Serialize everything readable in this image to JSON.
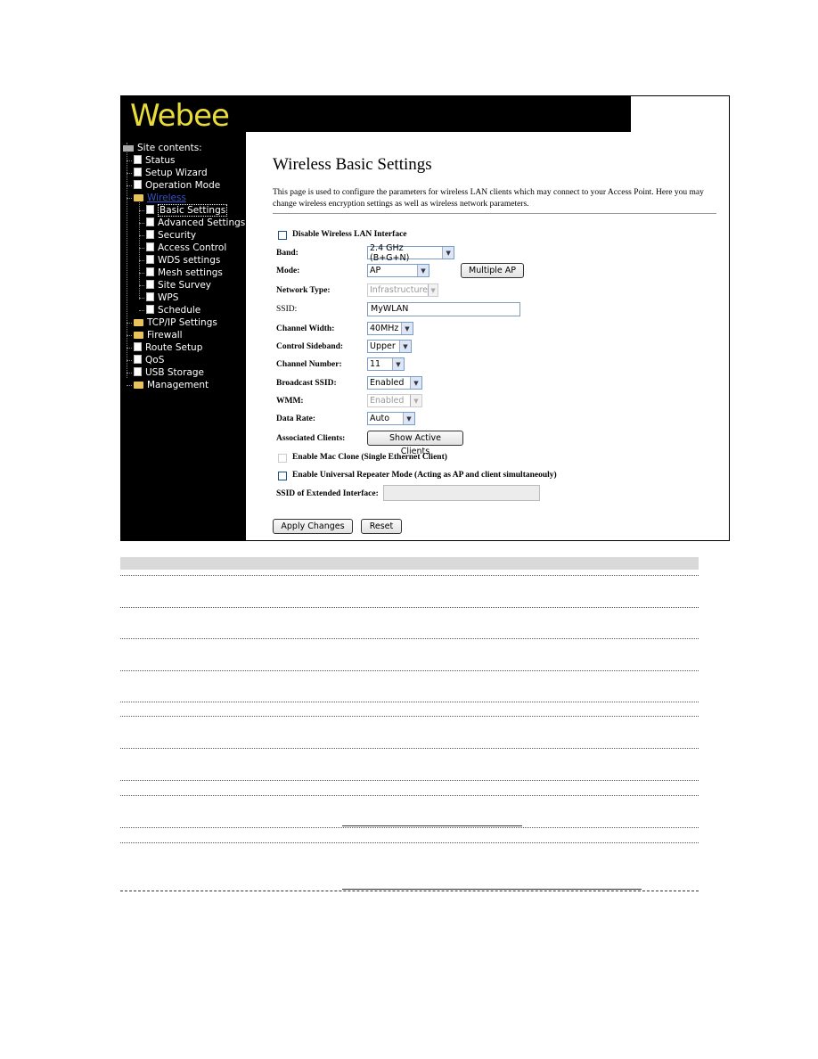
{
  "app": {
    "logo_text": "Webee"
  },
  "sidebar": {
    "root_label": "Site contents:",
    "items": [
      {
        "label": "Status",
        "type": "page",
        "level": 1
      },
      {
        "label": "Setup Wizard",
        "type": "page",
        "level": 1
      },
      {
        "label": "Operation Mode",
        "type": "page",
        "level": 1
      },
      {
        "label": "Wireless",
        "type": "folder-open",
        "level": 1
      },
      {
        "label": "Basic Settings",
        "type": "page",
        "level": 2,
        "selected": true
      },
      {
        "label": "Advanced Settings",
        "type": "page",
        "level": 2
      },
      {
        "label": "Security",
        "type": "page",
        "level": 2
      },
      {
        "label": "Access Control",
        "type": "page",
        "level": 2
      },
      {
        "label": "WDS settings",
        "type": "page",
        "level": 2
      },
      {
        "label": "Mesh settings",
        "type": "page",
        "level": 2
      },
      {
        "label": "Site Survey",
        "type": "page",
        "level": 2
      },
      {
        "label": "WPS",
        "type": "page",
        "level": 2
      },
      {
        "label": "Schedule",
        "type": "page",
        "level": 2
      },
      {
        "label": "TCP/IP Settings",
        "type": "folder",
        "level": 1
      },
      {
        "label": "Firewall",
        "type": "folder",
        "level": 1
      },
      {
        "label": "Route Setup",
        "type": "page",
        "level": 1
      },
      {
        "label": "QoS",
        "type": "page",
        "level": 1
      },
      {
        "label": "USB Storage",
        "type": "page",
        "level": 1
      },
      {
        "label": "Management",
        "type": "folder",
        "level": 1
      }
    ]
  },
  "main": {
    "title": "Wireless Basic Settings",
    "description": "This page is used to configure the parameters for wireless LAN clients which may connect to your Access Point. Here you may change wireless encryption settings as well as wireless network parameters.",
    "disable_wlan": {
      "label": "Disable Wireless LAN Interface",
      "checked": false
    },
    "band": {
      "label": "Band:",
      "value": "2.4 GHz (B+G+N)"
    },
    "mode": {
      "label": "Mode:",
      "value": "AP",
      "multiple_ap_button": "Multiple AP"
    },
    "network_type": {
      "label": "Network Type:",
      "value": "Infrastructure",
      "disabled": true
    },
    "ssid": {
      "label": "SSID:",
      "value": "MyWLAN"
    },
    "channel_width": {
      "label": "Channel Width:",
      "value": "40MHz"
    },
    "control_sideband": {
      "label": "Control Sideband:",
      "value": "Upper"
    },
    "channel_number": {
      "label": "Channel Number:",
      "value": "11"
    },
    "broadcast_ssid": {
      "label": "Broadcast SSID:",
      "value": "Enabled"
    },
    "wmm": {
      "label": "WMM:",
      "value": "Enabled",
      "disabled": true
    },
    "data_rate": {
      "label": "Data Rate:",
      "value": "Auto"
    },
    "associated_clients": {
      "label": "Associated Clients:",
      "button": "Show Active Clients"
    },
    "mac_clone": {
      "label": "Enable Mac Clone (Single Ethernet Client)",
      "checked": false,
      "disabled": true
    },
    "universal_repeater": {
      "label": "Enable Universal Repeater Mode (Acting as AP and client simultaneouly)",
      "checked": false
    },
    "ssid_extended": {
      "label": "SSID of Extended Interface:",
      "value": "",
      "disabled": true
    },
    "apply_button": "Apply Changes",
    "reset_button": "Reset"
  }
}
